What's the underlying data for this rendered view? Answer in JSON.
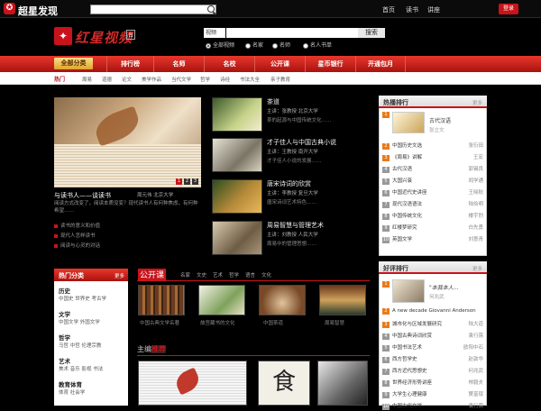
{
  "top": {
    "brand": "超星发现",
    "links": [
      "首页",
      "读书",
      "讲座"
    ],
    "login": "登录"
  },
  "header": {
    "logo_icon": "红",
    "logo_text": "红星视频",
    "badge": "台",
    "search_select": "视频",
    "search_btn": "搜索",
    "radios": [
      "全部视频",
      "名家",
      "名师",
      "名人书单"
    ]
  },
  "nav": {
    "all": "全部分类",
    "items": [
      "排行榜",
      "名师",
      "名校",
      "公开课",
      "星币银行",
      "开通包月"
    ]
  },
  "hot": {
    "label": "热门",
    "items": [
      "周易",
      "道德",
      "论文",
      "美学作品",
      "当代文学",
      "哲学",
      "诗经",
      "书法大全",
      "亲子教育"
    ]
  },
  "banner": {
    "pages": [
      "1",
      "2",
      "3"
    ],
    "title": "与读书人——谈读书",
    "meta": "周元伟 北京大学",
    "desc": "阅读方式改变了，阅读本质没变？现代读书人有何种焦虑，有何种希望……",
    "list": [
      "读书的意义和价值",
      "现代人怎样读书",
      "阅读与心灵的对话"
    ]
  },
  "topics": [
    {
      "title": "茶道",
      "meta": "主讲：张教授 北京大学",
      "desc": "茶的起源与中国传统文化……"
    },
    {
      "title": "才子佳人与中国古典小说",
      "meta": "主讲：王教授 南开大学",
      "desc": "才子佳人小说的发展……"
    },
    {
      "title": "唐宋诗词的欣赏",
      "meta": "主讲：李教授 复旦大学",
      "desc": "唐宋诗词艺术特色……"
    },
    {
      "title": "周易智慧与管理艺术",
      "meta": "主讲：刘教授 人民大学",
      "desc": "周易中的管理思想……"
    }
  ],
  "rank1": {
    "title": "热播排行",
    "more": "更多",
    "feature_title": "古代汉语",
    "feature_author": "张立文",
    "items": [
      {
        "n": "2",
        "t": "中国历史文选",
        "a": "张衍田"
      },
      {
        "n": "3",
        "t": "《周易》讲解",
        "a": "王宏"
      },
      {
        "n": "4",
        "t": "古代汉语",
        "a": "郭锡良"
      },
      {
        "n": "5",
        "t": "大国兴衰",
        "a": "阎学通"
      },
      {
        "n": "6",
        "t": "中国近代史讲座",
        "a": "王晓秋"
      },
      {
        "n": "7",
        "t": "现代汉语语法",
        "a": "陆俭明"
      },
      {
        "n": "8",
        "t": "中国传统文化",
        "a": "楼宇烈"
      },
      {
        "n": "9",
        "t": "红楼梦研究",
        "a": "白先勇"
      },
      {
        "n": "10",
        "t": "英国文学",
        "a": "刘意青"
      }
    ]
  },
  "rank2": {
    "title": "好评排行",
    "more": "更多",
    "feature_title": "\"本我本人...",
    "feature_author": "何兆武",
    "items": [
      {
        "n": "2",
        "t": "A new decade Giovanni Anderson",
        "a": ""
      },
      {
        "n": "3",
        "t": "城市化与区域发展研究",
        "a": "陆大道"
      },
      {
        "n": "4",
        "t": "中国古典诗词欣赏",
        "a": "袁行霈"
      },
      {
        "n": "5",
        "t": "中国书法艺术",
        "a": "欧阳中石"
      },
      {
        "n": "6",
        "t": "西方哲学史",
        "a": "赵敦华"
      },
      {
        "n": "7",
        "t": "西方近代思想史",
        "a": "何兆武"
      },
      {
        "n": "8",
        "t": "世界经济形势讲座",
        "a": "林毅夫"
      },
      {
        "n": "9",
        "t": "大学生心理健康",
        "a": "樊富珉"
      },
      {
        "n": "10",
        "t": "中国古代文学",
        "a": "袁行霈"
      }
    ]
  },
  "categories": {
    "title": "热门分类",
    "more": "更多",
    "groups": [
      {
        "title": "历史",
        "links": "中国史 世界史 考古学"
      },
      {
        "title": "文学",
        "links": "中国文学 外国文学"
      },
      {
        "title": "哲学",
        "links": "马哲 中哲 伦理宗教"
      },
      {
        "title": "艺术",
        "links": "美术 音乐 影视 书法"
      },
      {
        "title": "教育体育",
        "links": "体育 社会学"
      }
    ]
  },
  "open": {
    "title": "公开课",
    "tabs": [
      "名家",
      "文史",
      "艺术",
      "哲学",
      "语言",
      "文化"
    ],
    "caps": [
      "中国古典文学名著",
      "故宫藏书的文化",
      "中国茶道",
      "周易智慧"
    ]
  },
  "recommend": {
    "pre": "主编",
    "title": "推荐",
    "food_char": "食"
  }
}
